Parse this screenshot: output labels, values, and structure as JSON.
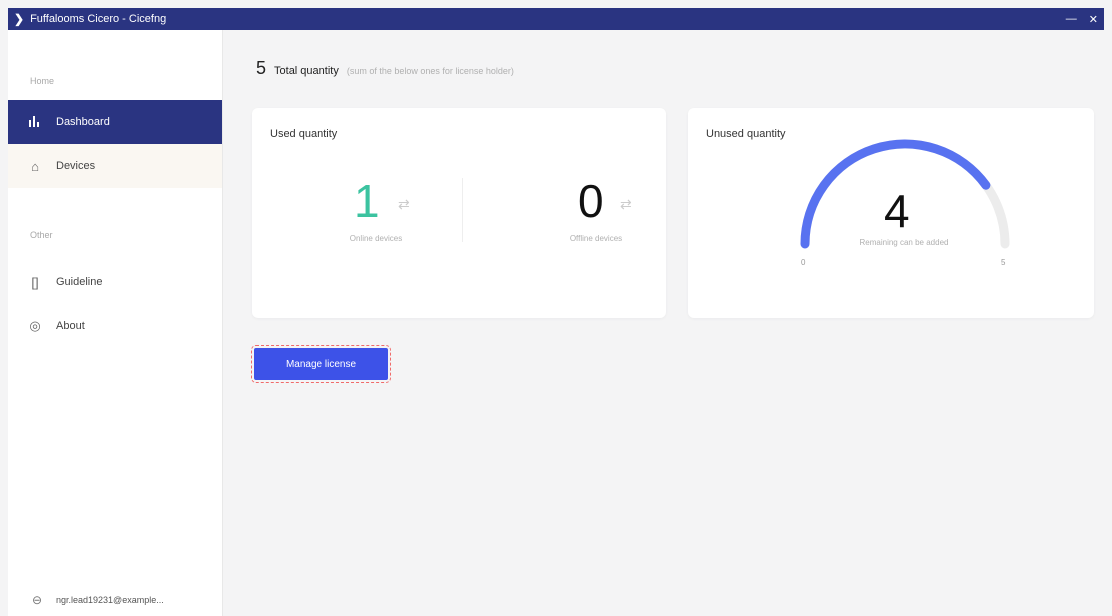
{
  "window": {
    "title": "Fuffalooms Cicero - Cicefng",
    "controls": [
      "—",
      "✕"
    ]
  },
  "sidebar": {
    "section1_label": "Home",
    "items": [
      {
        "label": "Dashboard",
        "icon": "bar-chart-icon"
      },
      {
        "label": "Devices",
        "icon": "device-icon"
      }
    ],
    "section2_label": "Other",
    "items2": [
      {
        "label": "Guideline",
        "icon": "book-icon"
      },
      {
        "label": "About",
        "icon": "info-icon"
      }
    ],
    "user": "ngr.lead19231@example..."
  },
  "total": {
    "value": "5",
    "label": "Total quantity",
    "subtitle": "(sum of the below ones for license holder)"
  },
  "used_card": {
    "title": "Used quantity",
    "online_value": "1",
    "online_caption": "Online devices",
    "offline_value": "0",
    "offline_caption": "Offline devices"
  },
  "unused_card": {
    "title": "Unused quantity",
    "value": "4",
    "caption": "Remaining can be added",
    "gauge_min": "0",
    "gauge_max": "5",
    "gauge_fraction": 0.8
  },
  "actions": {
    "manage_license": "Manage license"
  },
  "colors": {
    "accent": "#2a3481",
    "button": "#3d52e8",
    "online": "#3cc3a0",
    "gauge": "#5872f0"
  }
}
